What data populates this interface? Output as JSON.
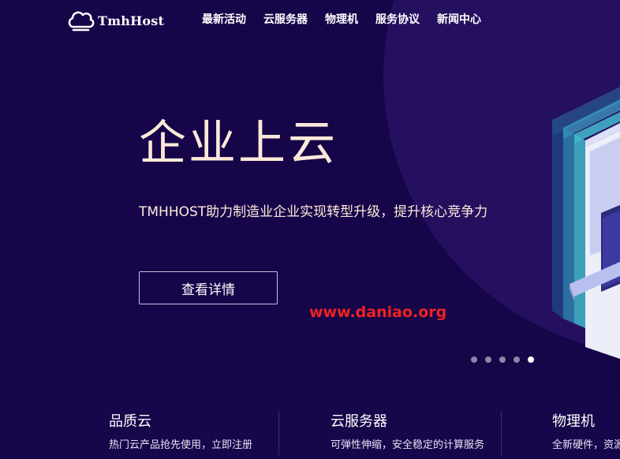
{
  "nav": {
    "logo_text": "TmhHost",
    "items": [
      "最新活动",
      "云服务器",
      "物理机",
      "服务协议",
      "新闻中心"
    ]
  },
  "hero": {
    "title": "企业上云",
    "subtitle": "TMHHOST助力制造业企业实现转型升级，提升核心竞争力",
    "button_label": "查看详情",
    "watermark": "www.daniao.org",
    "slides": {
      "count": 5,
      "active_index": 4
    }
  },
  "features": [
    {
      "title": "品质云",
      "desc": "热门云产品抢先使用，立即注册"
    },
    {
      "title": "云服务器",
      "desc": "可弹性伸缩，安全稳定的计算服务"
    },
    {
      "title": "物理机",
      "desc": "全新硬件，资源"
    }
  ],
  "colors": {
    "background": "#16064a",
    "accent_circle": "#24105f",
    "hero_text": "#fde9d9",
    "watermark": "#ee2222"
  },
  "icons": {
    "logo": "cloud-logo-icon"
  }
}
